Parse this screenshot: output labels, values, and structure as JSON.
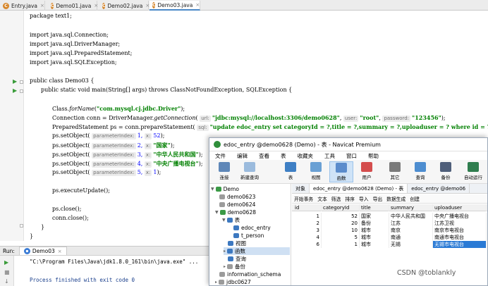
{
  "ide": {
    "tabs": [
      {
        "label": "Entry.java"
      },
      {
        "label": "Demo01.java"
      },
      {
        "label": "Demo02.java"
      },
      {
        "label": "Demo03.java"
      }
    ],
    "code": {
      "l_package": "package text1;",
      "l_imp1": "import java.sql.Connection;",
      "l_imp2": "import java.sql.DriverManager;",
      "l_imp3": "import java.sql.PreparedStatement;",
      "l_imp4": "import java.sql.SQLException;",
      "l_class": "public class Demo03 {",
      "l_main": "public static void main(String[] args) throws ClassNotFoundException, SQLException {",
      "forname_pre": "Class.",
      "forname_m": "forName",
      "forname_arg": "\"com.mysql.cj.jdbc.Driver\"",
      "forname_post": ");",
      "conn_pre": "Connection conn = DriverManager.",
      "conn_m": "getConnection",
      "hint_url": "url:",
      "conn_url": "\"jdbc:mysql://localhost:3306/demo0628\"",
      "hint_user": "user:",
      "conn_user": "\"root\"",
      "hint_password": "password:",
      "conn_pass": "\"123456\"",
      "ps_pre": "PreparedStatement ps = conn.prepareStatement(",
      "hint_sql": "sql:",
      "ps_sql": "\"update edoc_entry set categoryId = ?,title = ?,summary = ?,uploaduser = ? where id = ?\"",
      "ps_post": ");",
      "so_pre": "ps.setObject(",
      "hint_pi": "parameterIndex:",
      "hint_x": "x:",
      "so1_idx": "1,",
      "so1_val": "52",
      "so2_idx": "2,",
      "so2_val": "\"国家\"",
      "so3_idx": "3,",
      "so3_val": "\"中华人民共和国\"",
      "so4_idx": "4,",
      "so4_val": "\"中央广播电视台\"",
      "so5_idx": "5,",
      "so5_val": "1",
      "so_end": ");",
      "exec": "ps.executeUpdate();",
      "close1": "ps.close();",
      "close2": "conn.close();",
      "brace": "}",
      "brace2": "}"
    },
    "run": {
      "label": "Run:",
      "tab": "Demo03",
      "line1": "\"C:\\Program Files\\Java\\jdk1.8.0_161\\bin\\java.exe\" ...",
      "line2": "Process finished with exit code 0"
    }
  },
  "navicat": {
    "title": "edoc_entry @demo0628 (Demo) - 表 - Navicat Premium",
    "menu": [
      "文件",
      "编辑",
      "查看",
      "表",
      "收藏夹",
      "工具",
      "窗口",
      "帮助"
    ],
    "toolbar": [
      "连接",
      "新建查询",
      "表",
      "视图",
      "函数",
      "用户",
      "其它",
      "查询",
      "备份",
      "自动运行"
    ],
    "tree": {
      "root": "Demo",
      "db1": "demo0623",
      "db2": "demo0624",
      "db3": "demo0628",
      "tables": "表",
      "t1": "edoc_entry",
      "t2": "t_person",
      "views": "视图",
      "funcs": "函数",
      "queries": "查询",
      "backups": "备份",
      "schema": "information_schema",
      "db4": "jdbc0627"
    },
    "obj_tabs": [
      "对象",
      "edoc_entry @demo0628 (Demo) - 表",
      "edoc_entry @demo06"
    ],
    "subtool": [
      "开始事务",
      "文本",
      "筛选",
      "排序",
      "导入",
      "导出",
      "数据生成",
      "创建"
    ],
    "grid": {
      "columns": [
        "id",
        "categoryId",
        "title",
        "summary",
        "uploaduser"
      ],
      "rows": [
        [
          "1",
          "52",
          "国家",
          "中华人民共和国",
          "中央广播电视台"
        ],
        [
          "2",
          "20",
          "备份",
          "江苏",
          "江苏卫视"
        ],
        [
          "3",
          "10",
          "城市",
          "南京",
          "南京市电视台"
        ],
        [
          "4",
          "5",
          "城市",
          "南通",
          "南通市电视台"
        ],
        [
          "6",
          "1",
          "城市",
          "无锡",
          "无锡市电视台"
        ]
      ]
    }
  },
  "watermark": "CSDN @toblankly"
}
